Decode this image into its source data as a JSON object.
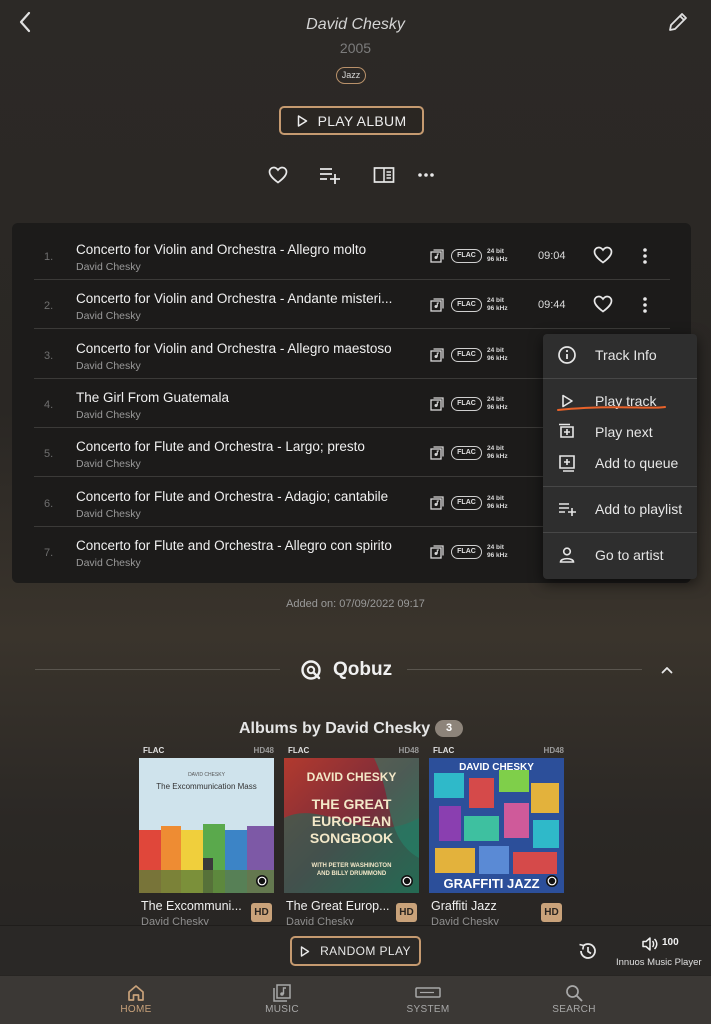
{
  "header": {
    "artist": "David Chesky",
    "year": "2005",
    "genre": "Jazz",
    "play_album_label": "PLAY ALBUM"
  },
  "tracks": [
    {
      "num": "1.",
      "title": "Concerto for Violin and Orchestra - Allegro molto",
      "artist": "David Chesky",
      "format": "FLAC",
      "bit_depth": "24 bit",
      "sample_rate": "96 kHz",
      "duration": "09:04"
    },
    {
      "num": "2.",
      "title": "Concerto for Violin and Orchestra - Andante misteri...",
      "artist": "David Chesky",
      "format": "FLAC",
      "bit_depth": "24 bit",
      "sample_rate": "96 kHz",
      "duration": "09:44"
    },
    {
      "num": "3.",
      "title": "Concerto for Violin and Orchestra - Allegro maestoso",
      "artist": "David Chesky",
      "format": "FLAC",
      "bit_depth": "24 bit",
      "sample_rate": "96 kHz"
    },
    {
      "num": "4.",
      "title": "The Girl From Guatemala",
      "artist": "David Chesky",
      "format": "FLAC",
      "bit_depth": "24 bit",
      "sample_rate": "96 kHz"
    },
    {
      "num": "5.",
      "title": "Concerto for Flute and Orchestra - Largo; presto",
      "artist": "David Chesky",
      "format": "FLAC",
      "bit_depth": "24 bit",
      "sample_rate": "96 kHz"
    },
    {
      "num": "6.",
      "title": "Concerto for Flute and Orchestra - Adagio; cantabile",
      "artist": "David Chesky",
      "format": "FLAC",
      "bit_depth": "24 bit",
      "sample_rate": "96 kHz"
    },
    {
      "num": "7.",
      "title": "Concerto for Flute and Orchestra - Allegro con spirito",
      "artist": "David Chesky",
      "format": "FLAC",
      "bit_depth": "24 bit",
      "sample_rate": "96 kHz"
    }
  ],
  "context_menu": {
    "track_info": "Track Info",
    "play_track": "Play track",
    "play_next": "Play next",
    "add_to_queue": "Add to queue",
    "add_to_playlist": "Add to playlist",
    "go_to_artist": "Go to artist"
  },
  "added_on": "Added on: 07/09/2022 09:17",
  "qobuz": {
    "name": "Qobuz",
    "albums_title": "Albums by David Chesky",
    "albums_count": "3",
    "albums": [
      {
        "format": "FLAC",
        "quality": "HD48",
        "title": "The Excommuni...",
        "artist": "David Chesky",
        "badge": "HD",
        "cover_artist": "DAVID CHESKY",
        "cover_title": "The Excommunication Mass"
      },
      {
        "format": "FLAC",
        "quality": "HD48",
        "title": "The Great Europ...",
        "artist": "David Chesky",
        "badge": "HD",
        "cover_artist": "DAVID CHESKY",
        "cover_l1": "THE GREAT",
        "cover_l2": "EUROPEAN",
        "cover_l3": "SONGBOOK",
        "cover_l4": "WITH PETER WASHINGTON",
        "cover_l5": "AND BILLY DRUMMOND"
      },
      {
        "format": "FLAC",
        "quality": "HD48",
        "title": "Graffiti Jazz",
        "artist": "David Chesky",
        "badge": "HD",
        "cover_artist": "DAVID CHESKY",
        "cover_title": "GRAFFITI JAZZ"
      }
    ]
  },
  "player": {
    "random_play_label": "RANDOM PLAY",
    "volume": "100",
    "device": "Innuos Music Player"
  },
  "nav": [
    {
      "label": "HOME"
    },
    {
      "label": "MUSIC"
    },
    {
      "label": "SYSTEM"
    },
    {
      "label": "SEARCH"
    }
  ],
  "colors": {
    "accent": "#c59a70",
    "menu_underline": "#e8622a",
    "active_nav": "#c9a27a"
  }
}
